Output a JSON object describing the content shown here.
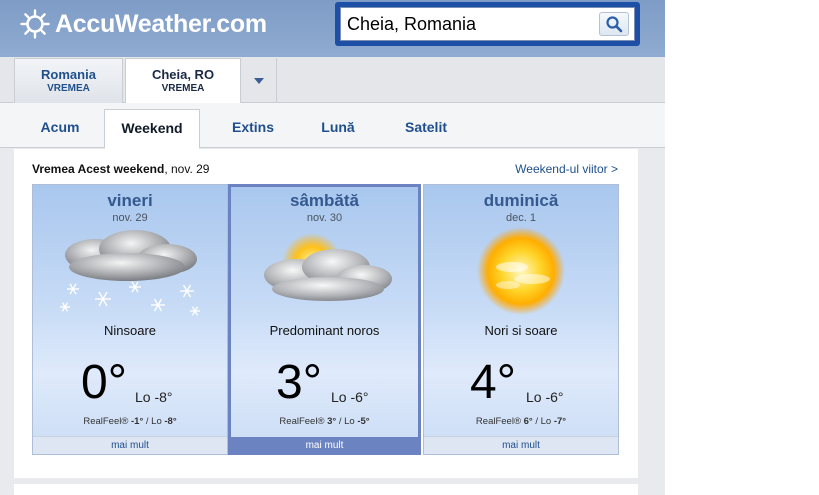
{
  "header": {
    "logo_text": "AccuWeather.com",
    "search": {
      "value": "Cheia, Romania",
      "icon": "search-icon"
    }
  },
  "location_tabs": [
    {
      "name": "Romania",
      "sub": "VREMEA",
      "active": false
    },
    {
      "name": "Cheia, RO",
      "sub": "VREMEA",
      "active": true
    }
  ],
  "nav_tabs": [
    {
      "label": "Acum",
      "active": false
    },
    {
      "label": "Weekend",
      "active": true
    },
    {
      "label": "Extins",
      "active": false
    },
    {
      "label": "Lună",
      "active": false
    },
    {
      "label": "Satelit",
      "active": false
    }
  ],
  "content": {
    "title_bold": "Vremea Acest weekend",
    "title_date": ", nov. 29",
    "next_link": "Weekend-ul viitor >"
  },
  "days": [
    {
      "name": "vineri",
      "date": "nov. 29",
      "condition": "Ninsoare",
      "icon": "snow-cloud-icon",
      "temp": "0°",
      "lo": "Lo -8°",
      "rf_label": "RealFeel® ",
      "rf_hi": "-1°",
      "rf_sep": " / Lo ",
      "rf_lo": "-8°",
      "more": "mai mult",
      "selected": false
    },
    {
      "name": "sâmbătă",
      "date": "nov. 30",
      "condition": "Predominant noros",
      "icon": "mostly-cloudy-icon",
      "temp": "3°",
      "lo": "Lo -6°",
      "rf_label": "RealFeel® ",
      "rf_hi": "3°",
      "rf_sep": " / Lo ",
      "rf_lo": "-5°",
      "more": "mai mult",
      "selected": true
    },
    {
      "name": "duminică",
      "date": "dec. 1",
      "condition": "Nori si soare",
      "icon": "sun-clouds-icon",
      "temp": "4°",
      "lo": "Lo -6°",
      "rf_label": "RealFeel® ",
      "rf_hi": "6°",
      "rf_sep": " / Lo ",
      "rf_lo": "-7°",
      "more": "mai mult",
      "selected": false
    }
  ],
  "colors": {
    "header_bg": "#8fabd1",
    "search_border": "#1e4fa6",
    "link": "#1f4f8c",
    "day_name": "#35598f",
    "selected_border": "#6c83c2"
  }
}
